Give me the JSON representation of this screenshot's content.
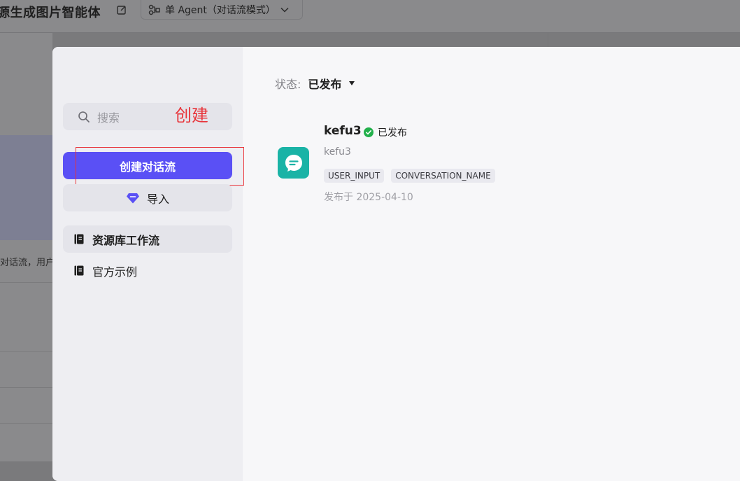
{
  "background": {
    "title": "源生成图片智能体",
    "mode_label": "单 Agent（对话流模式）",
    "snippet": "对话流，用户"
  },
  "sidebar": {
    "search_placeholder": "搜索",
    "create_button": "创建对话流",
    "import_button": "导入",
    "nav": [
      {
        "label": "资源库工作流",
        "active": true
      },
      {
        "label": "官方示例",
        "active": false
      }
    ]
  },
  "annotation": {
    "label": "创建",
    "color": "#e8343a"
  },
  "filter": {
    "label": "状态:",
    "value": "已发布"
  },
  "workflows": [
    {
      "name": "kefu3",
      "status": "已发布",
      "description": "kefu3",
      "tags": [
        "USER_INPUT",
        "CONVERSATION_NAME"
      ],
      "published": "发布于 2025-04-10",
      "icon": "chat-bubble-icon"
    }
  ],
  "colors": {
    "primary": "#5a50f5",
    "success": "#22b04b",
    "icon_bg": "#1ab3a6"
  }
}
